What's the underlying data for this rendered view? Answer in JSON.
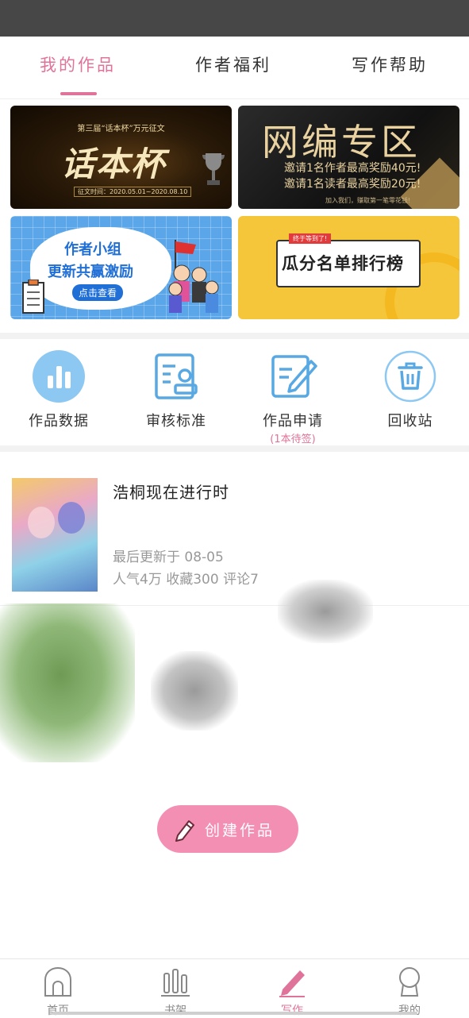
{
  "tabs": [
    {
      "label": "我的作品",
      "active": true
    },
    {
      "label": "作者福利",
      "active": false
    },
    {
      "label": "写作帮助",
      "active": false
    }
  ],
  "banners": {
    "b1": {
      "subtitle": "第三届“话本杯”万元征文",
      "title": "话本杯",
      "date": "征文时间：2020.05.01~2020.08.10"
    },
    "b2": {
      "title": "网编专区",
      "line1": "邀请1名作者最高奖励40元!",
      "line2": "邀请1名读者最高奖励20元!",
      "footer": "加入我们，赚取第一笔零花钱!"
    },
    "b3": {
      "line1": "作者小组",
      "line2": "更新共赢激励",
      "button": "点击查看"
    },
    "b4": {
      "tag": "终于等到了!",
      "title": "瓜分名单排行榜"
    }
  },
  "actions": [
    {
      "label": "作品数据",
      "icon": "bar-chart-icon"
    },
    {
      "label": "审核标准",
      "icon": "review-document-icon"
    },
    {
      "label": "作品申请",
      "sub": "(1本待签)",
      "icon": "edit-document-icon"
    },
    {
      "label": "回收站",
      "icon": "trash-icon"
    }
  ],
  "book": {
    "title": "浩桐现在进行时",
    "updated": "最后更新于 08-05",
    "stats": "人气4万 收藏300 评论7"
  },
  "create_button": "创建作品",
  "bottom_nav": [
    {
      "label": "首页",
      "active": false,
      "icon": "home-icon"
    },
    {
      "label": "书架",
      "active": false,
      "icon": "bookshelf-icon"
    },
    {
      "label": "写作",
      "active": true,
      "icon": "pen-icon"
    },
    {
      "label": "我的",
      "active": false,
      "icon": "profile-icon"
    }
  ],
  "colors": {
    "accent": "#e0739a",
    "icon_blue": "#58a9e3",
    "button_pink": "#f48fb4"
  }
}
